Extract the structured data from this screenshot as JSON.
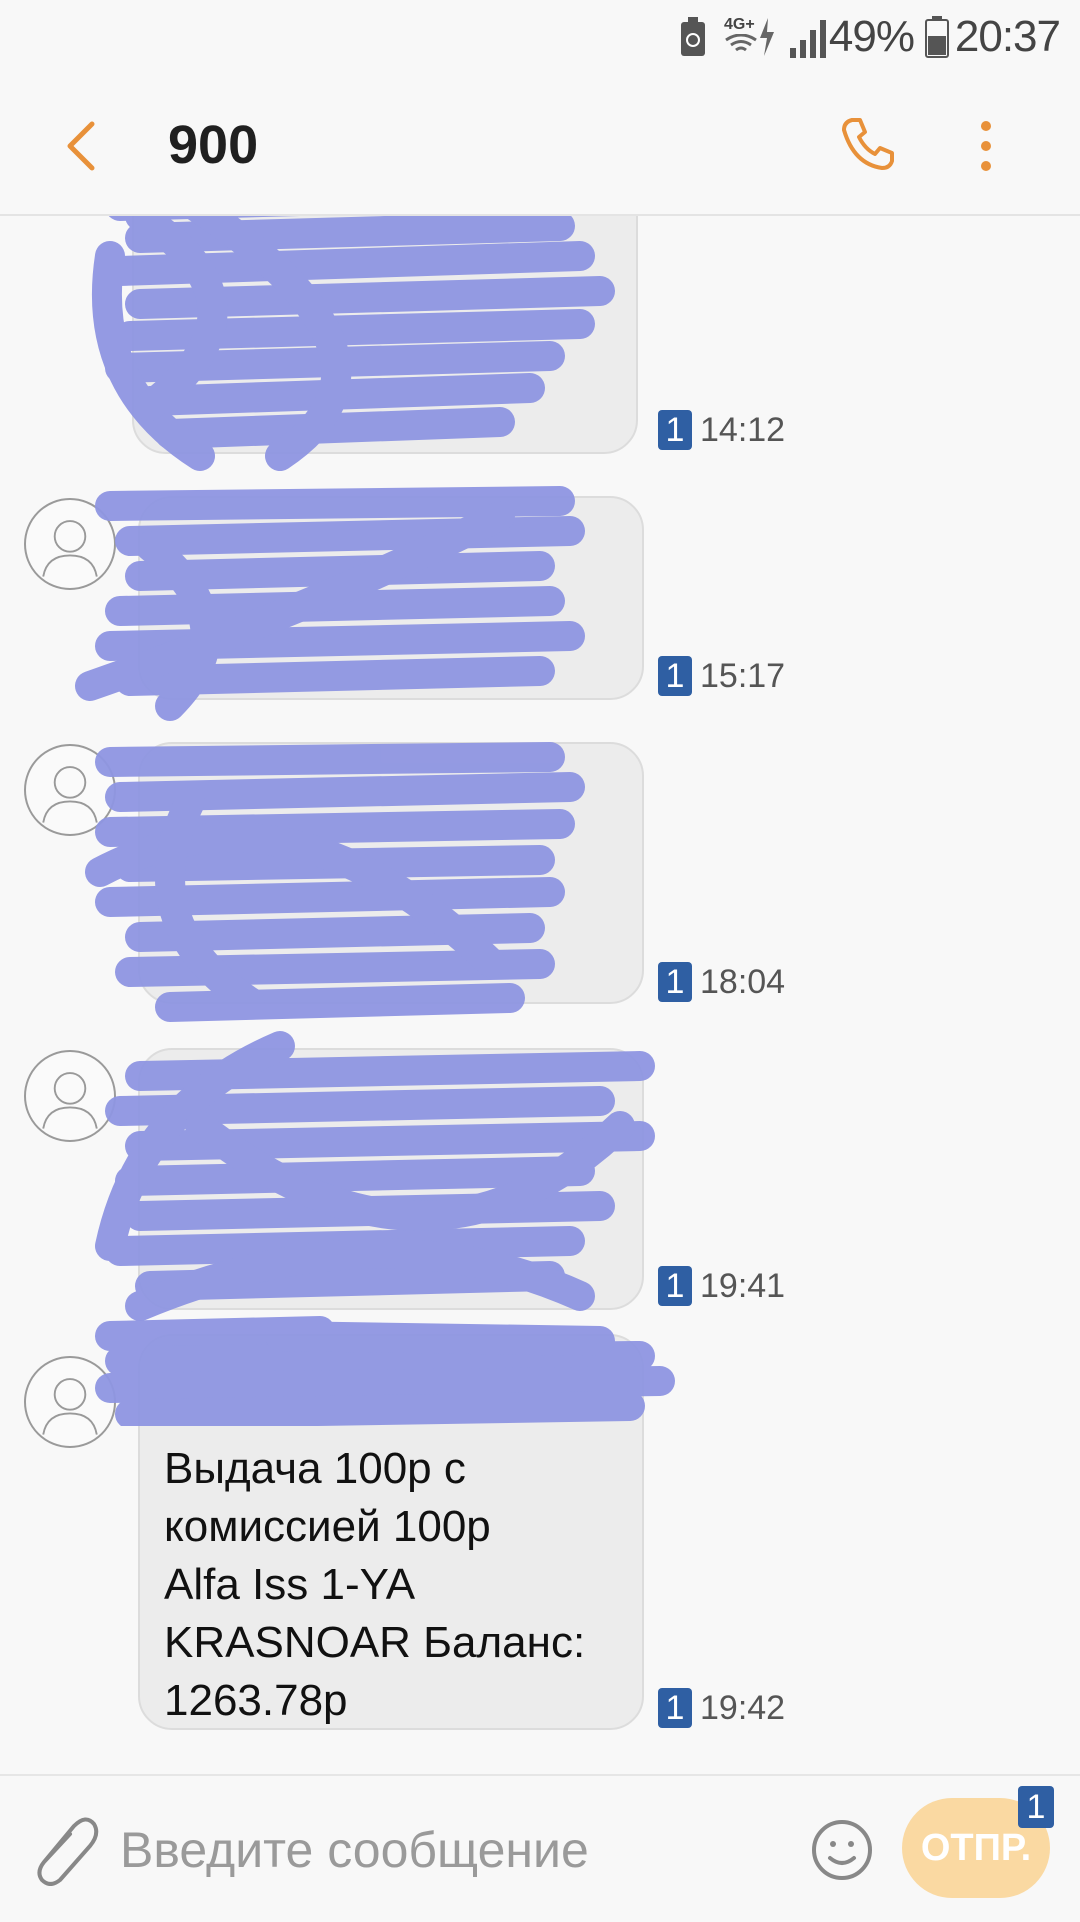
{
  "status_bar": {
    "network": "4G+",
    "battery_percent": "49%",
    "time": "20:37"
  },
  "header": {
    "title": "900",
    "back_icon": "chevron-left-icon",
    "call_icon": "phone-icon",
    "menu_icon": "more-vertical-icon"
  },
  "messages": [
    {
      "text": "",
      "sim": "1",
      "time": "14:12"
    },
    {
      "text": "",
      "sim": "1",
      "time": "15:17"
    },
    {
      "text": "",
      "sim": "1",
      "time": "18:04"
    },
    {
      "text": "",
      "sim": "1",
      "time": "19:41"
    },
    {
      "text": "Выдача 100р с\nкомиссией 100р\nAlfa Iss 1-YA\nKRASNOAR Баланс:\n1263.78р",
      "sim": "1",
      "time": "19:42"
    }
  ],
  "composer": {
    "placeholder": "Введите сообщение",
    "send_label": "ОТПР.",
    "send_sim": "1",
    "attach_icon": "paperclip-icon",
    "emoji_icon": "smiley-icon"
  },
  "colors": {
    "accent": "#e8913a",
    "bubble": "#ececec",
    "sim_badge": "#2f5fa3",
    "send_button": "#fad9a2",
    "redaction": "#8f96e2"
  }
}
